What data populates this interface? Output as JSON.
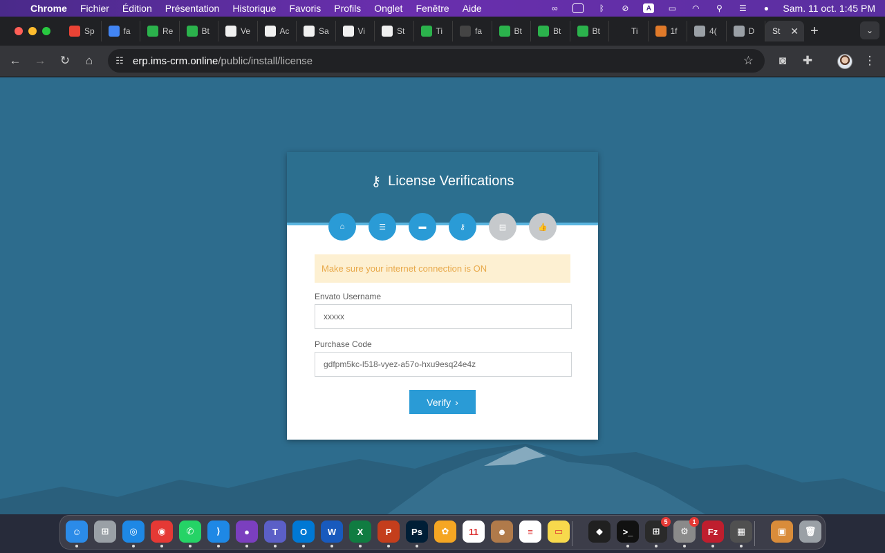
{
  "menubar": {
    "app": "Chrome",
    "items": [
      "Fichier",
      "Édition",
      "Présentation",
      "Historique",
      "Favoris",
      "Profils",
      "Onglet",
      "Fenêtre",
      "Aide"
    ],
    "status": {
      "input_source": "A",
      "datetime": "Sam. 11 oct.  1:45 PM"
    }
  },
  "tabs": [
    {
      "label": "Sp",
      "icon": "gmail-icon",
      "color": "#ea4335"
    },
    {
      "label": "fa",
      "icon": "google-icon",
      "color": "#4285f4"
    },
    {
      "label": "Re",
      "icon": "bolt-icon",
      "color": "#2bb24c"
    },
    {
      "label": "Bt",
      "icon": "bolt-icon",
      "color": "#2bb24c"
    },
    {
      "label": "Ve",
      "icon": "doc-icon",
      "color": "#f0f0f0"
    },
    {
      "label": "Ac",
      "icon": "doc-icon",
      "color": "#f0f0f0"
    },
    {
      "label": "Sa",
      "icon": "doc-icon",
      "color": "#f0f0f0"
    },
    {
      "label": "Vi",
      "icon": "doc-icon",
      "color": "#f0f0f0"
    },
    {
      "label": "St",
      "icon": "doc-icon",
      "color": "#f0f0f0"
    },
    {
      "label": "Ti",
      "icon": "bolt-icon",
      "color": "#2bb24c"
    },
    {
      "label": "fa",
      "icon": "pattern-icon",
      "color": "#444444"
    },
    {
      "label": "Bt",
      "icon": "bolt-icon",
      "color": "#2bb24c"
    },
    {
      "label": "Bt",
      "icon": "bolt-icon",
      "color": "#2bb24c"
    },
    {
      "label": "Bt",
      "icon": "bolt-icon",
      "color": "#2bb24c"
    },
    {
      "label": "Ti",
      "icon": "cl-icon",
      "color": "#202124"
    },
    {
      "label": "1f",
      "icon": "fire-icon",
      "color": "#e07a2a"
    },
    {
      "label": "4(",
      "icon": "globe-icon",
      "color": "#9aa0a6"
    },
    {
      "label": "D",
      "icon": "globe-icon",
      "color": "#9aa0a6"
    }
  ],
  "active_tab": {
    "label": "St"
  },
  "toolbar": {
    "url_host": "erp.ims-crm.online",
    "url_path": "/public/install/license"
  },
  "page": {
    "title": "License Verifications",
    "steps": [
      {
        "icon": "home-icon",
        "glyph": "⌂",
        "done": true
      },
      {
        "icon": "list-icon",
        "glyph": "☰",
        "done": true
      },
      {
        "icon": "folder-icon",
        "glyph": "▬",
        "done": true
      },
      {
        "icon": "key-icon",
        "glyph": "⚷",
        "done": true
      },
      {
        "icon": "database-icon",
        "glyph": "▤",
        "done": false
      },
      {
        "icon": "thumbs-up-icon",
        "glyph": "👍",
        "done": false
      }
    ],
    "alert": "Make sure your internet connection is ON",
    "username_label": "Envato Username",
    "username_value": "xxxxx",
    "code_label": "Purchase Code",
    "code_value": "gdfpm5kc-l518-vyez-a57o-hxu9esq24e4z",
    "verify_label": "Verify",
    "colors": {
      "primary": "#2a9bd6",
      "header": "#2c6f8f",
      "alert_bg": "#fdf0d2",
      "alert_text": "#e8a94a"
    }
  },
  "dock": {
    "items": [
      {
        "name": "finder-icon",
        "color": "#2b8be8",
        "glyph": "☺"
      },
      {
        "name": "launchpad-icon",
        "color": "#9aa0a6",
        "glyph": "⊞"
      },
      {
        "name": "safari-icon",
        "color": "#1e88e5",
        "glyph": "◎"
      },
      {
        "name": "chrome-icon",
        "color": "#e53935",
        "glyph": "◉"
      },
      {
        "name": "whatsapp-icon",
        "color": "#25d366",
        "glyph": "✆"
      },
      {
        "name": "vscode-icon",
        "color": "#1e88e5",
        "glyph": "⟩"
      },
      {
        "name": "github-icon",
        "color": "#7b3fbf",
        "glyph": "●"
      },
      {
        "name": "teams-icon",
        "color": "#5b5fc7",
        "glyph": "T"
      },
      {
        "name": "outlook-icon",
        "color": "#0078d4",
        "glyph": "O"
      },
      {
        "name": "word-icon",
        "color": "#185abd",
        "glyph": "W"
      },
      {
        "name": "excel-icon",
        "color": "#107c41",
        "glyph": "X"
      },
      {
        "name": "powerpoint-icon",
        "color": "#c43e1c",
        "glyph": "P"
      },
      {
        "name": "photoshop-icon",
        "color": "#001e36",
        "glyph": "Ps"
      },
      {
        "name": "photos-icon",
        "color": "#f5a623",
        "glyph": "✿"
      },
      {
        "name": "calendar-icon",
        "color": "#ffffff",
        "glyph": "11"
      },
      {
        "name": "contacts-icon",
        "color": "#b07a4a",
        "glyph": "☻"
      },
      {
        "name": "reminders-icon",
        "color": "#ffffff",
        "glyph": "≡"
      },
      {
        "name": "notes-icon",
        "color": "#f7d94c",
        "glyph": "▭"
      },
      {
        "name": "box-icon",
        "color": "#202020",
        "glyph": "◆"
      },
      {
        "name": "terminal-icon",
        "color": "#111111",
        "glyph": ">_"
      },
      {
        "name": "microsoft-store-icon",
        "color": "#2a2a2a",
        "glyph": "⊞",
        "badge": "5"
      },
      {
        "name": "system-settings-icon",
        "color": "#8a8a8a",
        "glyph": "⚙",
        "badge": "1"
      },
      {
        "name": "filezilla-icon",
        "color": "#bf1e2e",
        "glyph": "Fz"
      },
      {
        "name": "calculator-icon",
        "color": "#505050",
        "glyph": "▦"
      },
      {
        "name": "archive-icon",
        "color": "#d98c3a",
        "glyph": "▣"
      },
      {
        "name": "trash-icon",
        "color": "#9aa0a6",
        "glyph": "🗑"
      }
    ]
  }
}
